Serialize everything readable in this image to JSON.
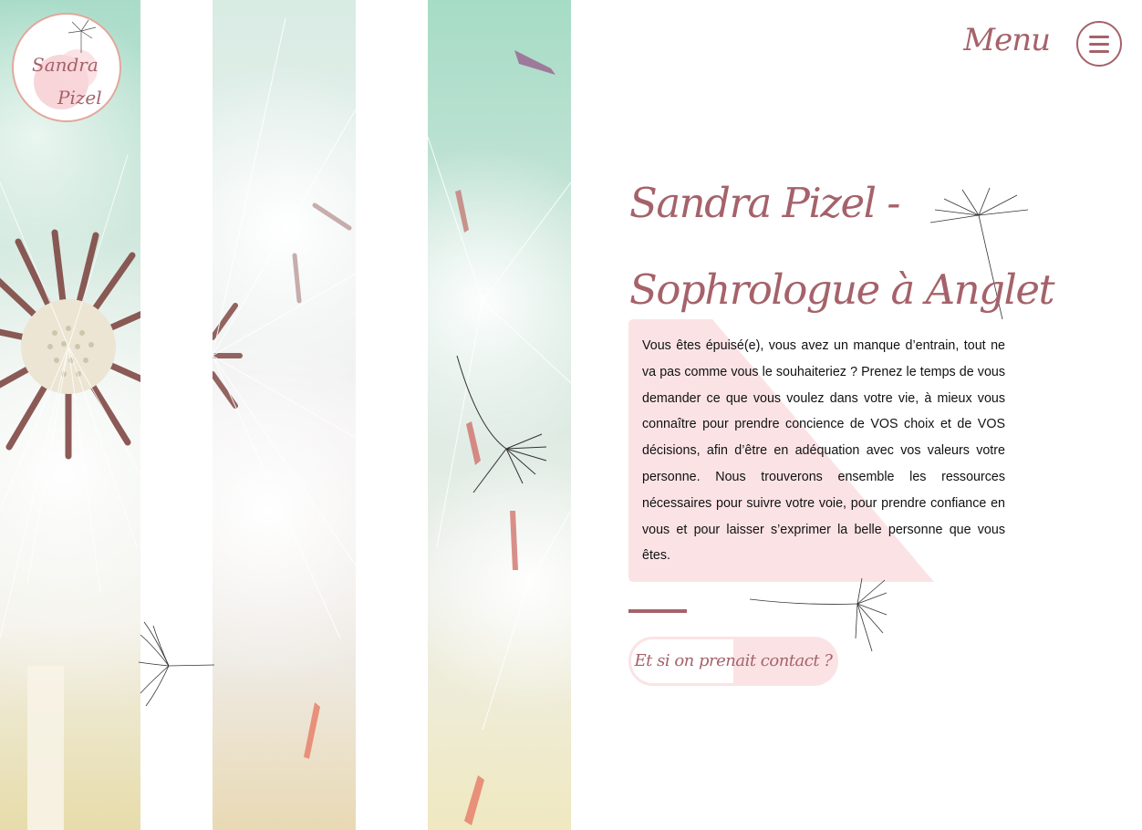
{
  "logo": {
    "line1": "Sandra",
    "line2": "Pizel"
  },
  "header": {
    "menu_label": "Menu",
    "menu_icon": "hamburger-menu-icon"
  },
  "hero": {
    "title": "Sandra Pizel - Sophrologue à Anglet",
    "intro": "Vous êtes épuisé(e), vous avez un manque d’entrain, tout ne va pas comme vous le souhaiteriez ? Prenez le temps de vous demander ce que vous voulez dans votre vie, à mieux vous connaître pour prendre concience de VOS choix et de VOS décisions, afin d’être en adéquation avec vos valeurs votre personne. Nous trouverons ensemble les ressources nécessaires pour suivre votre voie, pour prendre confiance en vous et pour laisser s’exprimer la belle personne que vous êtes.",
    "cta_label": "Et si on prenait contact ?"
  },
  "colors": {
    "accent": "#a5626a",
    "accent_light": "#fbe3e5",
    "logo_border": "#e2a89c"
  }
}
